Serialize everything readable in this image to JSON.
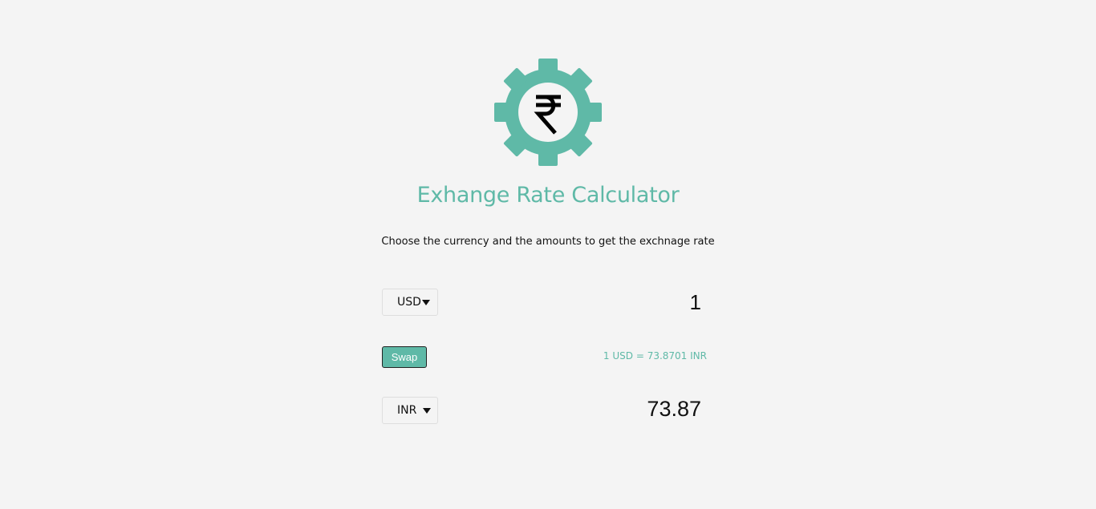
{
  "app": {
    "logo_icon": "rupee-gear-icon",
    "accent_color": "#5fb9a7",
    "title": "Exhange Rate Calculator",
    "subtitle": "Choose the currency and the amounts to get the exchnage rate"
  },
  "converter": {
    "currency_one": {
      "selected": "USD",
      "icon": "chevron-down-icon"
    },
    "amount_one": "1",
    "swap_label": "Swap",
    "rate_text": "1 USD = 73.8701 INR",
    "currency_two": {
      "selected": "INR",
      "icon": "chevron-down-icon"
    },
    "amount_two": "73.87"
  }
}
